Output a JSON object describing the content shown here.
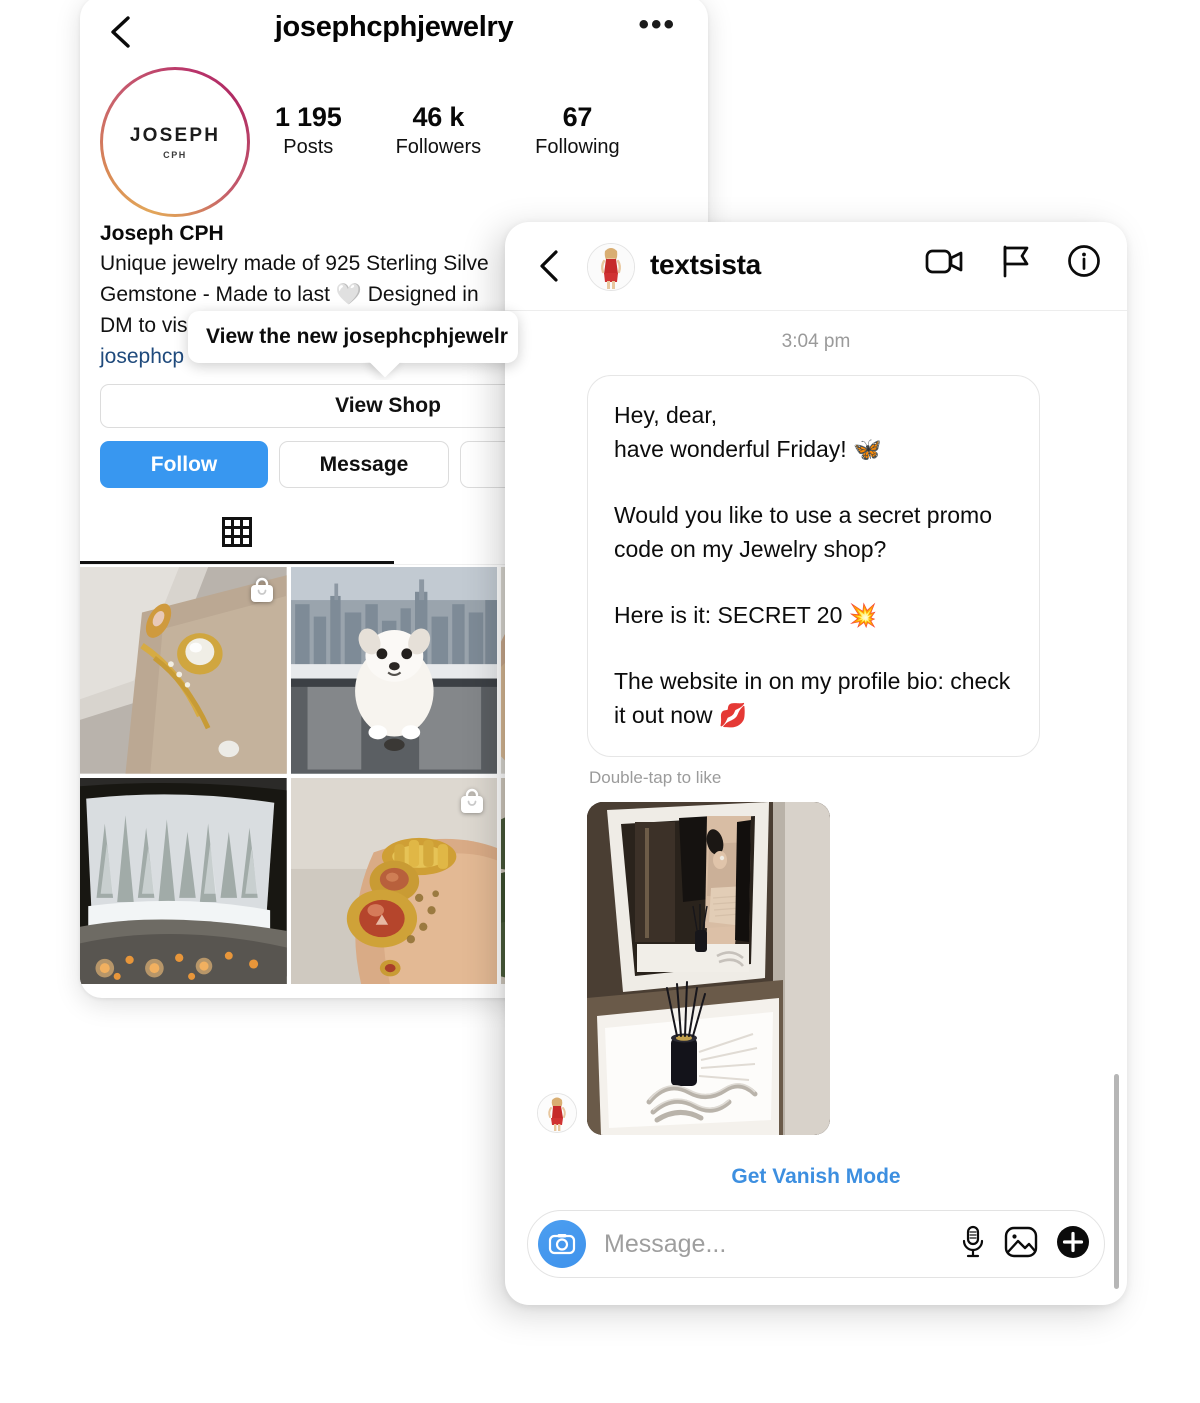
{
  "profile": {
    "back_icon": "back-chevron-icon",
    "username": "josephcphjewelry",
    "more_icon": "more-options-icon",
    "avatar": {
      "brand": "JOSEPH",
      "sub": "CPH"
    },
    "stats": [
      {
        "value": "1 195",
        "label": "Posts"
      },
      {
        "value": "46 k",
        "label": "Followers"
      },
      {
        "value": "67",
        "label": "Following"
      }
    ],
    "bio": {
      "display_name": "Joseph CPH",
      "lines": [
        "Unique jewelry made of 925 Sterling Silve",
        "Gemstone - Made to last 🤍 Designed in",
        "DM to vis"
      ],
      "link": "josephcp"
    },
    "buttons": {
      "view_shop": "View Shop",
      "follow": "Follow",
      "message": "Message",
      "extra": ""
    },
    "tabs": [
      {
        "name": "grid-tab",
        "icon": "grid-icon",
        "active": true
      },
      {
        "name": "shop-tab",
        "icon": "shopping-bag-icon",
        "active": false
      }
    ],
    "grid": [
      {
        "alt": "gold rings on finger",
        "shop_badge": true
      },
      {
        "alt": "white pomeranian dog at city window",
        "shop_badge": false
      },
      {
        "alt": "partially hidden post",
        "shop_badge": false
      },
      {
        "alt": "snowy forest from car window",
        "shop_badge": false
      },
      {
        "alt": "gold rings with red gemstone",
        "shop_badge": true
      },
      {
        "alt": "partially hidden post",
        "shop_badge": false
      }
    ]
  },
  "tooltip": {
    "text": "View the new josephcphjewelr"
  },
  "dm": {
    "back_icon": "back-chevron-icon",
    "username": "textsista",
    "avatar_alt": "woman in red dress",
    "actions": [
      {
        "name": "video-call-icon"
      },
      {
        "name": "flag-icon"
      },
      {
        "name": "info-icon"
      }
    ],
    "timestamp": "3:04 pm",
    "message_paragraphs": [
      "Hey, dear,\nhave wonderful Friday! 🦋",
      "Would you like to use a secret promo code on my Jewelry shop?",
      "Here is it: SECRET 20 💥",
      "The website in on my profile bio: check it out now 💋"
    ],
    "double_tap_hint": "Double-tap to like",
    "attachment_alt": "mirror selfie with diffuser and silver chains",
    "vanish_mode": "Get Vanish Mode",
    "composer": {
      "camera_icon": "camera-icon",
      "placeholder": "Message...",
      "value": "",
      "icons": [
        {
          "name": "microphone-icon"
        },
        {
          "name": "photo-icon"
        },
        {
          "name": "plus-icon"
        }
      ]
    }
  },
  "colors": {
    "follow_blue": "#3897f0",
    "link_blue": "#3d8fe0",
    "bio_link": "#1f4a7c"
  }
}
